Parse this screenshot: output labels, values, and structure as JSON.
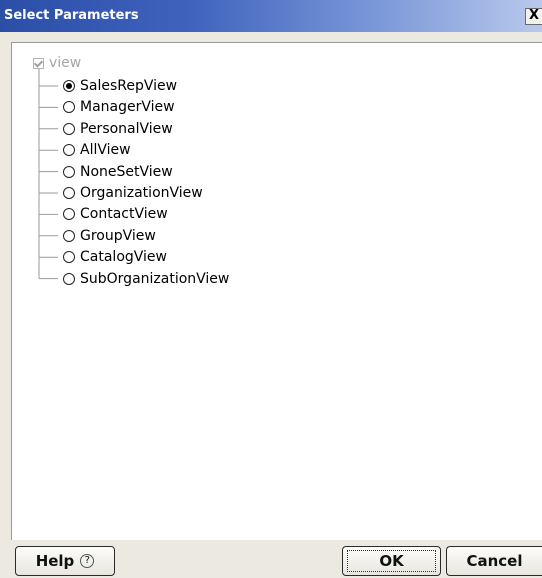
{
  "window": {
    "title": "Select Parameters",
    "close_label": "X"
  },
  "tree": {
    "root_label": "view",
    "root_checked": true,
    "selected_index": 0,
    "items": [
      {
        "label": "SalesRepView"
      },
      {
        "label": "ManagerView"
      },
      {
        "label": "PersonalView"
      },
      {
        "label": "AllView"
      },
      {
        "label": "NoneSetView"
      },
      {
        "label": "OrganizationView"
      },
      {
        "label": "ContactView"
      },
      {
        "label": "GroupView"
      },
      {
        "label": "CatalogView"
      },
      {
        "label": "SubOrganizationView"
      }
    ]
  },
  "buttons": {
    "help_label": "Help",
    "help_icon_glyph": "?",
    "ok_label": "OK",
    "cancel_label": "Cancel"
  },
  "colors": {
    "titlebar_start": "#2b4ea7",
    "titlebar_end": "#b9c9ec",
    "dialog_bg": "#ece9e0",
    "disabled_text": "#a6a6a6"
  }
}
